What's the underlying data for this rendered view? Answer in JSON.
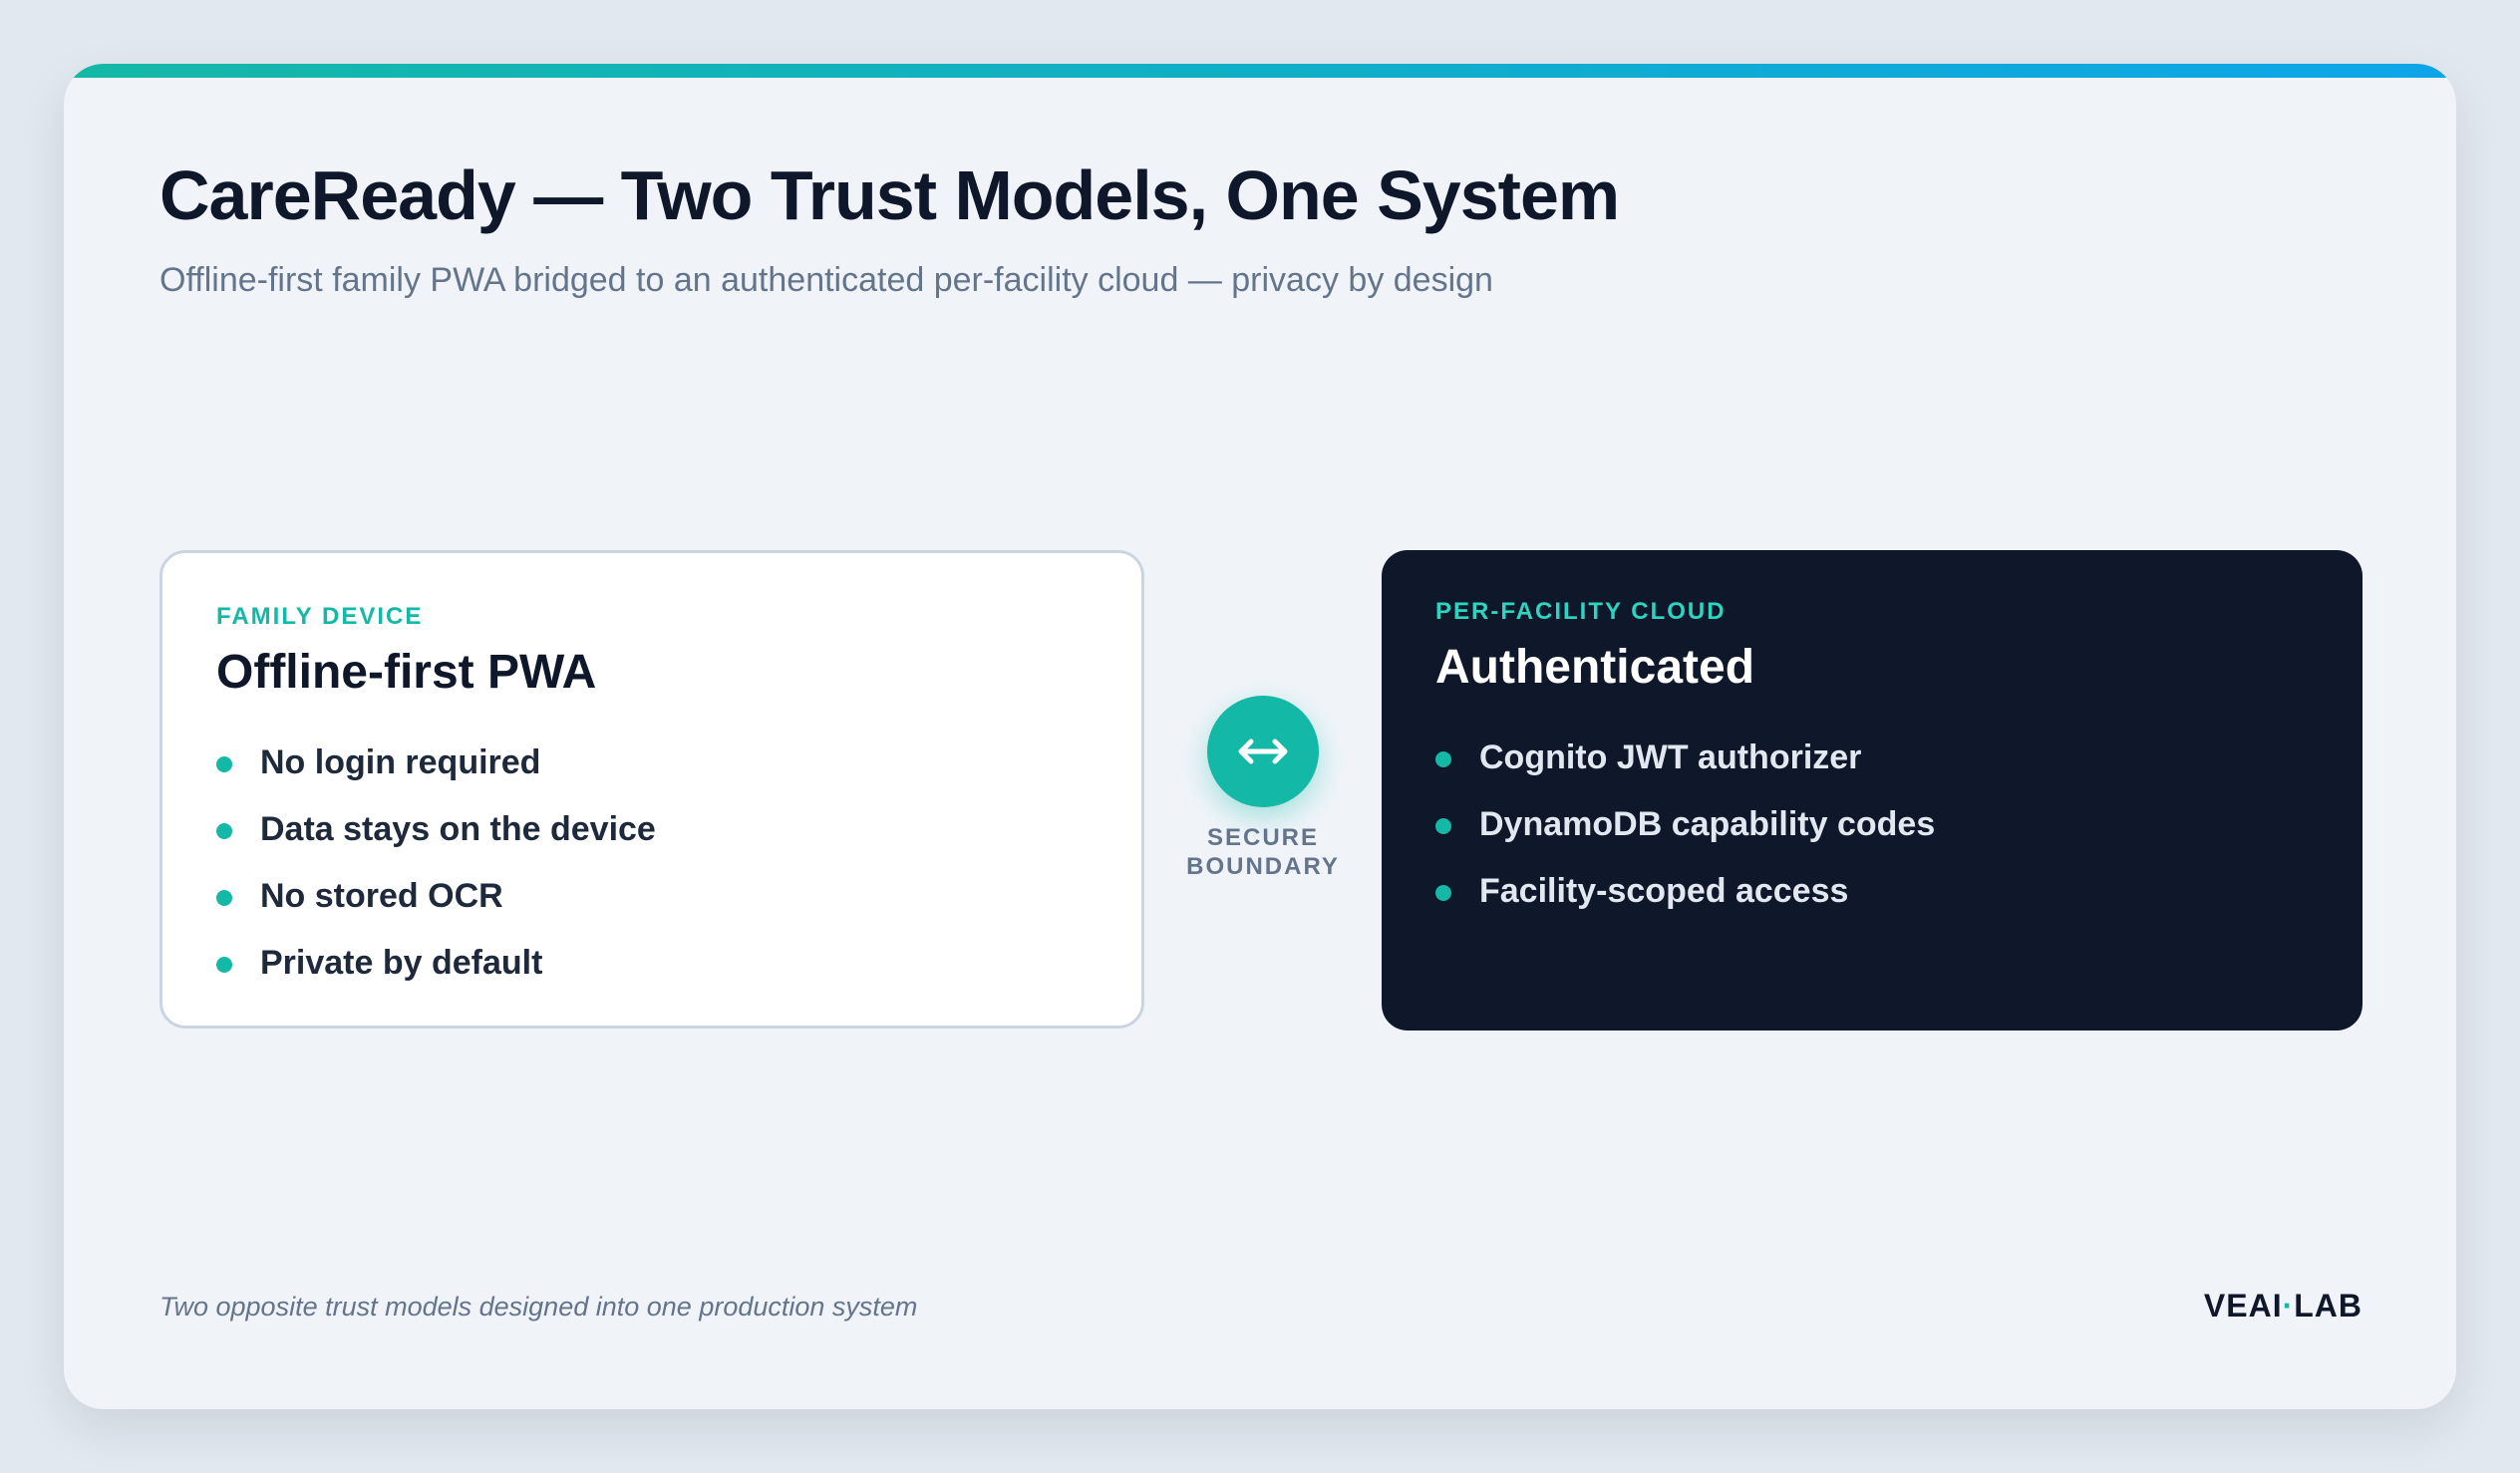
{
  "header": {
    "title": "CareReady — Two Trust Models, One System",
    "subtitle": "Offline-first family PWA bridged to an authenticated per-facility cloud — privacy by design"
  },
  "family_card": {
    "eyebrow": "FAMILY DEVICE",
    "heading": "Offline-first PWA",
    "bullets": [
      "No login required",
      "Data stays on the device",
      "No stored OCR",
      "Private by default"
    ]
  },
  "bridge": {
    "icon": "left-right-arrow-icon",
    "label_line1": "SECURE",
    "label_line2": "BOUNDARY"
  },
  "cloud_card": {
    "eyebrow": "PER-FACILITY CLOUD",
    "heading": "Authenticated",
    "bullets": [
      "Cognito JWT authorizer",
      "DynamoDB capability codes",
      "Facility-scoped access"
    ]
  },
  "footer": {
    "caption": "Two opposite trust models designed into one production system",
    "brand_left": "VEAI",
    "brand_separator": "·",
    "brand_right": "LAB"
  },
  "colors": {
    "accent": "#14b8a6",
    "accent_gradient_end": "#0ea5e9",
    "dark_card": "#0f172a",
    "slide_background": "#f0f4f9"
  }
}
